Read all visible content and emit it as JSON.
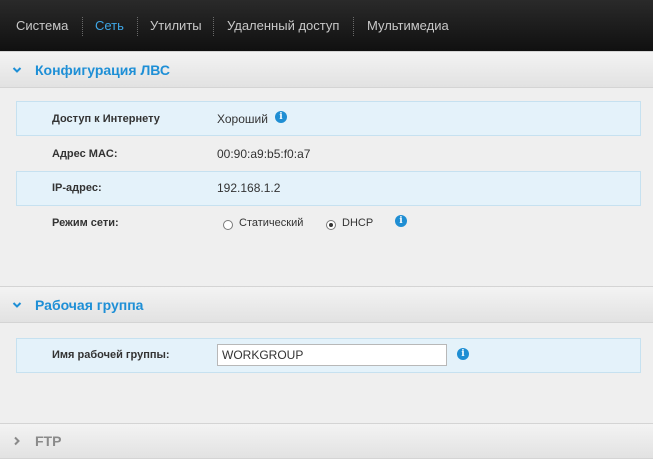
{
  "nav": {
    "tabs": [
      {
        "label": "Система",
        "active": false
      },
      {
        "label": "Сеть",
        "active": true
      },
      {
        "label": "Утилиты",
        "active": false
      },
      {
        "label": "Удаленный доступ",
        "active": false
      },
      {
        "label": "Мультимедиа",
        "active": false
      }
    ]
  },
  "lan": {
    "title": "Конфигурация ЛВС",
    "expanded": true,
    "internet_access": {
      "label": "Доступ к Интернету",
      "value": "Хороший"
    },
    "mac": {
      "label": "Адрес MAC:",
      "value": "00:90:a9:b5:f0:a7"
    },
    "ip": {
      "label": "IP-адрес:",
      "value": "192.168.1.2"
    },
    "network_mode": {
      "label": "Режим сети:",
      "options": [
        "Статический",
        "DHCP"
      ],
      "selected": "DHCP"
    }
  },
  "workgroup": {
    "title": "Рабочая группа",
    "expanded": true,
    "name": {
      "label": "Имя рабочей группы:",
      "value": "WORKGROUP"
    }
  },
  "ftp": {
    "title": "FTP",
    "expanded": false
  },
  "colors": {
    "accent": "#1e8fd6",
    "nav_bg": "#1a1a1a",
    "highlight_row": "#e4f2fa"
  },
  "icons": {
    "info": "info-icon",
    "expanded": "chevron-down-icon",
    "collapsed": "chevron-right-icon"
  }
}
